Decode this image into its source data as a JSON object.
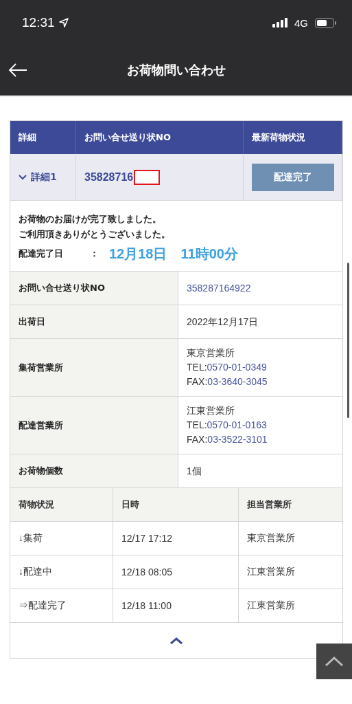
{
  "status_bar": {
    "time": "12:31",
    "network": "4G"
  },
  "nav": {
    "title": "お荷物問い合わせ"
  },
  "summary": {
    "columns": [
      "詳細",
      "お問い合せ送り状NO",
      "最新荷物状況"
    ],
    "row": {
      "detail_label": "詳細1",
      "expanded": true,
      "tracking_no": "35828716",
      "status_button": "配達完了"
    }
  },
  "message": {
    "lines": [
      "お荷物のお届けが完了致しました。",
      "ご利用頂きありがとうございました。"
    ],
    "date_label": "配達完了日",
    "separator": "：",
    "date": "12月18日",
    "time": "11時00分"
  },
  "details": [
    {
      "label": "お問い合せ送り状NO",
      "kind": "link",
      "value": "358287164922"
    },
    {
      "label": "出荷日",
      "kind": "text",
      "value": "2022年12月17日"
    },
    {
      "label": "集荷営業所",
      "kind": "office",
      "name": "東京営業所",
      "tel_label": "TEL:",
      "tel": "0570-01-0349",
      "fax_label": "FAX:",
      "fax": "03-3640-3045"
    },
    {
      "label": "配達営業所",
      "kind": "office",
      "name": "江東営業所",
      "tel_label": "TEL:",
      "tel": "0570-01-0163",
      "fax_label": "FAX:",
      "fax": "03-3522-3101"
    },
    {
      "label": "お荷物個数",
      "kind": "text",
      "value": "1個"
    }
  ],
  "history": {
    "columns": [
      "荷物状況",
      "日時",
      "担当営業所"
    ],
    "rows": [
      {
        "status": "↓集荷",
        "datetime": "12/17 17:12",
        "office": "東京営業所"
      },
      {
        "status": "↓配達中",
        "datetime": "12/18 08:05",
        "office": "江東営業所"
      },
      {
        "status": "⇒配達完了",
        "datetime": "12/18 11:00",
        "office": "江東営業所"
      }
    ]
  }
}
